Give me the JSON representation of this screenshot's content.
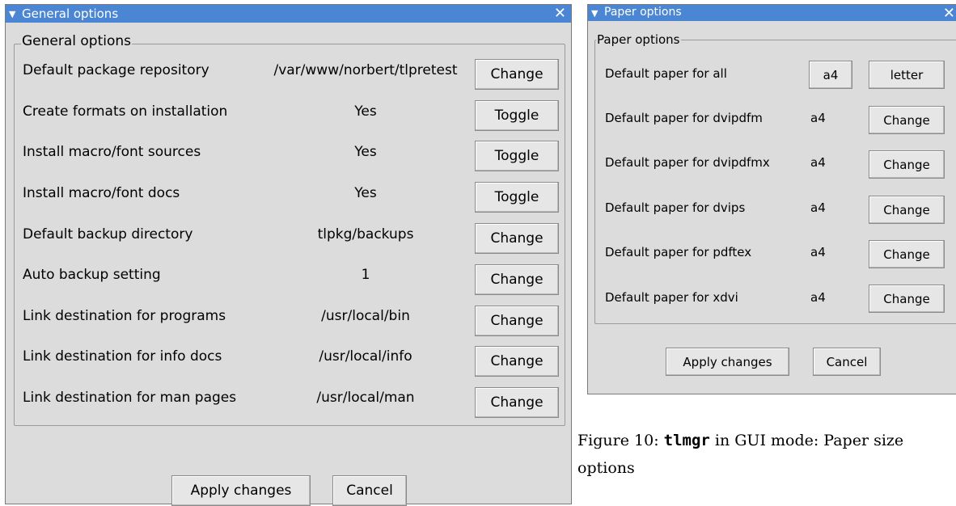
{
  "general_window": {
    "title": "General options",
    "group_label": "General options",
    "rows": [
      {
        "label": "Default package repository",
        "value": "/var/www/norbert/tlpretest",
        "button": "Change"
      },
      {
        "label": "Create formats on installation",
        "value": "Yes",
        "button": "Toggle"
      },
      {
        "label": "Install macro/font sources",
        "value": "Yes",
        "button": "Toggle"
      },
      {
        "label": "Install macro/font docs",
        "value": "Yes",
        "button": "Toggle"
      },
      {
        "label": "Default backup directory",
        "value": "tlpkg/backups",
        "button": "Change"
      },
      {
        "label": "Auto backup setting",
        "value": "1",
        "button": "Change"
      },
      {
        "label": "Link destination for programs",
        "value": "/usr/local/bin",
        "button": "Change"
      },
      {
        "label": "Link destination for info docs",
        "value": "/usr/local/info",
        "button": "Change"
      },
      {
        "label": "Link destination for man pages",
        "value": "/usr/local/man",
        "button": "Change"
      }
    ],
    "apply_label": "Apply changes",
    "cancel_label": "Cancel"
  },
  "paper_window": {
    "title": "Paper options",
    "group_label": "Paper options",
    "all_label": "Default paper for all",
    "all_a4": "a4",
    "all_letter": "letter",
    "rows": [
      {
        "label": "Default paper for dvipdfm",
        "value": "a4",
        "button": "Change"
      },
      {
        "label": "Default paper for dvipdfmx",
        "value": "a4",
        "button": "Change"
      },
      {
        "label": "Default paper for dvips",
        "value": "a4",
        "button": "Change"
      },
      {
        "label": "Default paper for pdftex",
        "value": "a4",
        "button": "Change"
      },
      {
        "label": "Default paper for xdvi",
        "value": "a4",
        "button": "Change"
      }
    ],
    "apply_label": "Apply changes",
    "cancel_label": "Cancel"
  },
  "caption": {
    "prefix": "Figure 10: ",
    "command": "tlmgr",
    "suffix": " in GUI mode: Paper size options"
  }
}
